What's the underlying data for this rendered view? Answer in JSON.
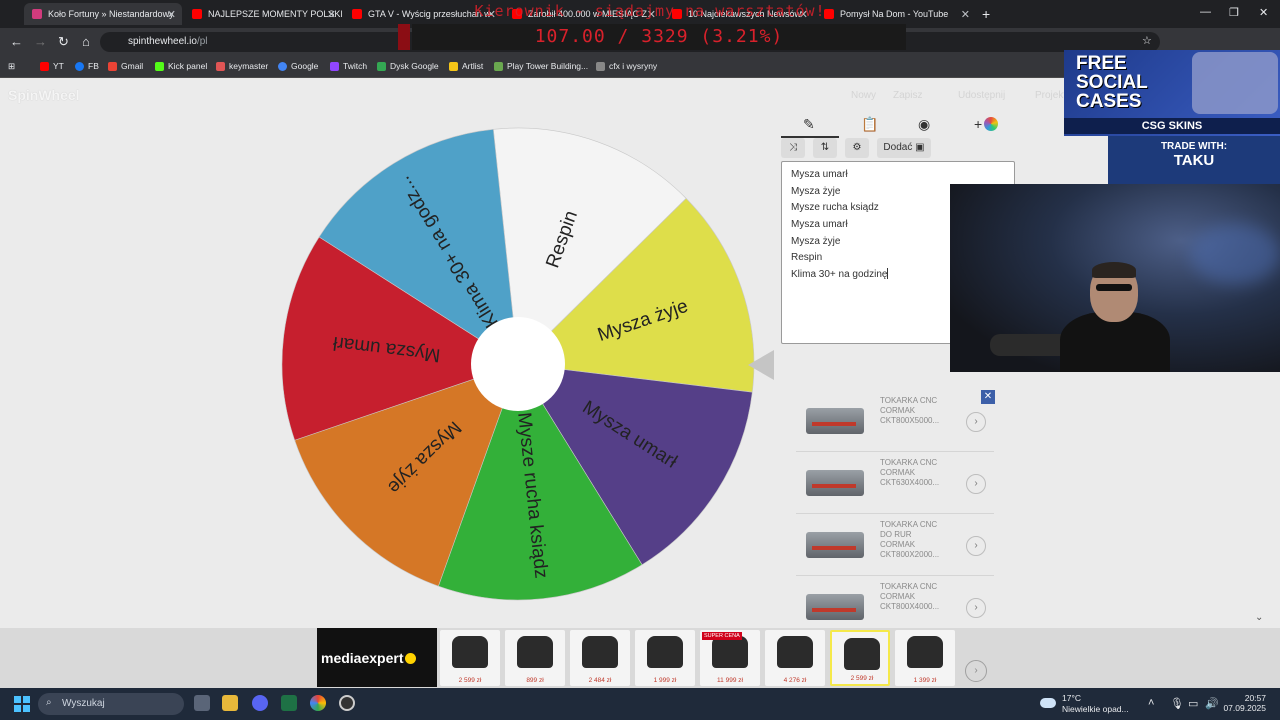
{
  "browser": {
    "tabs": [
      {
        "title": "Koło Fortuny » Niestandardowy",
        "active": true,
        "color": "#d23b7d"
      },
      {
        "title": "NAJLEPSZE MOMENTY POLSKIE",
        "active": false,
        "color": "#ff0000"
      },
      {
        "title": "GTA V - Wyścig przesłuchań w",
        "active": false,
        "color": "#ff0000"
      },
      {
        "title": "Zarobił 400.000 w MIESIĄC Z",
        "active": false,
        "color": "#ff0000"
      },
      {
        "title": "10 Najciekawszych Newsów",
        "active": false,
        "color": "#ff0000"
      },
      {
        "title": "Pomysł Na Dom - YouTube",
        "active": false,
        "color": "#ff0000"
      }
    ],
    "overlay_title": "Kierownik - siądajmy na warsztatów!",
    "url_site": "spinthewheel.io",
    "url_path": "/pl",
    "counter": "107.00 / 3329 (3.21%)",
    "bookmarks": [
      {
        "label": "YT",
        "color": "#ff0000"
      },
      {
        "label": "FB",
        "color": "#1877f2"
      },
      {
        "label": "Gmail",
        "color": "#ea4335"
      },
      {
        "label": "Kick panel",
        "color": "#53fc18"
      },
      {
        "label": "keymaster",
        "color": "#e05555"
      },
      {
        "label": "Google",
        "color": "#4285f4"
      },
      {
        "label": "Twitch",
        "color": "#9146ff"
      },
      {
        "label": "Dysk Google",
        "color": "#34a853"
      },
      {
        "label": "Artlist",
        "color": "#f5c518"
      },
      {
        "label": "Play Tower Building...",
        "color": "#6aa84f"
      },
      {
        "label": "cfx i wysryny",
        "color": "#888888"
      }
    ]
  },
  "site": {
    "logo": "SpinWheel",
    "menu": [
      "Nowy",
      "Zapisz",
      "Udostępnij",
      "Projekt"
    ]
  },
  "wheel": {
    "segments": [
      {
        "label": "Respin",
        "color": "#f4f4f4"
      },
      {
        "label": "Mysza żyje",
        "color": "#dede4a"
      },
      {
        "label": "Mysza umarł",
        "color": "#553f88"
      },
      {
        "label": "Mysze rucha ksiądz",
        "color": "#33b039"
      },
      {
        "label": "Mysza żyje",
        "color": "#d57726"
      },
      {
        "label": "Mysza umarł",
        "color": "#c61f2e"
      },
      {
        "label": "Klima 30+ na godz...",
        "color": "#4fa1c8"
      }
    ]
  },
  "panel": {
    "tabs": [
      "pencil-icon",
      "clipboard-icon",
      "eye-off-icon",
      "add-color-icon"
    ],
    "add_button": "Dodać",
    "entries": [
      "Mysza umarł",
      "Mysza żyje",
      "Mysze rucha ksiądz",
      "Mysza umarł",
      "Mysza żyje",
      "Respin",
      "Klima 30+ na godzinę"
    ]
  },
  "ads": {
    "top_right": {
      "line1": "FREE",
      "line2": "SOCIAL",
      "line3": "CASES",
      "brand": "CSG SKINS"
    },
    "trade": {
      "line1": "TRADE WITH:",
      "line2": "TAKU"
    },
    "items": [
      {
        "text": "TOKARKA CNC CORMAK CKT800X5000..."
      },
      {
        "text": "TOKARKA CNC CORMAK CKT630X4000..."
      },
      {
        "text": "TOKARKA CNC DO RUR CORMAK CKT800X2000..."
      },
      {
        "text": "TOKARKA CNC CORMAK CKT800X4000..."
      }
    ],
    "mediaexpert": "mediaexpert",
    "products": [
      {
        "price": "2 599 zł",
        "badge": ""
      },
      {
        "price": "899 zł",
        "badge": ""
      },
      {
        "price": "2 484 zł",
        "badge": ""
      },
      {
        "price": "1 999 zł",
        "badge": ""
      },
      {
        "price": "11 999 zł",
        "badge": "SUPER CENA"
      },
      {
        "price": "4 276 zł",
        "badge": ""
      },
      {
        "price": "2 599 zł",
        "badge": ""
      },
      {
        "price": "1 399 zł",
        "badge": ""
      }
    ]
  },
  "taskbar": {
    "search": "Wyszukaj",
    "weather_temp": "17°C",
    "weather_desc": "Niewielkie opad...",
    "time": "20:57",
    "date": "07.09.2025"
  }
}
